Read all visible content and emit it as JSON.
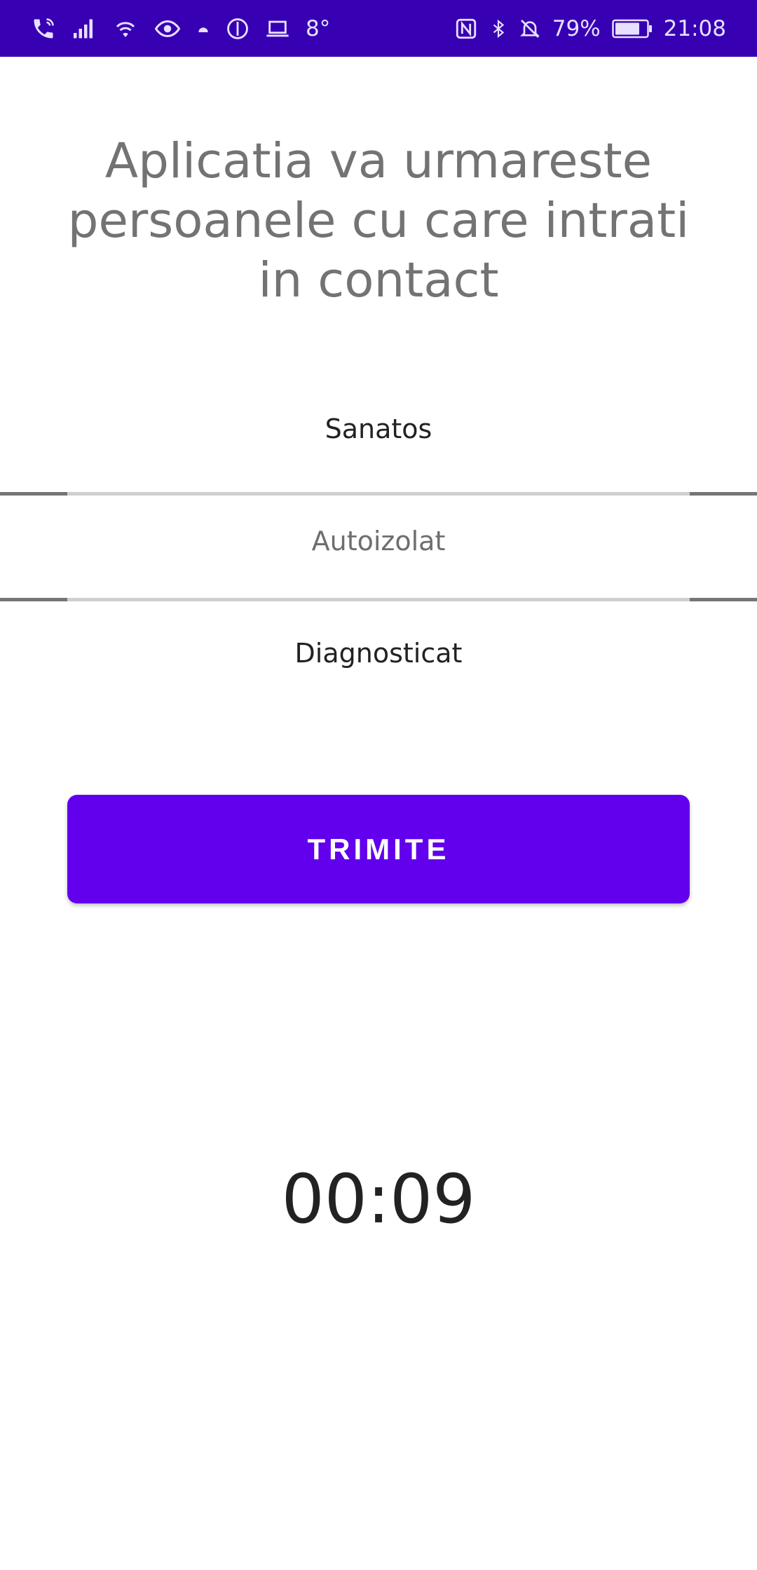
{
  "status_bar": {
    "temperature": "8°",
    "battery_percent": "79%",
    "time": "21:08",
    "background_color": "#3700b3",
    "icons_left": [
      "phone-wifi-calling-icon",
      "signal-icon",
      "wifi-icon",
      "eye-icon",
      "android-icon",
      "compass-icon",
      "laptop-icon"
    ],
    "icons_right": [
      "nfc-icon",
      "bluetooth-icon",
      "bell-off-icon",
      "battery-icon"
    ],
    "battery_level": 0.79
  },
  "headline": "Aplicatia va urmareste persoanele cu care intrati in contact",
  "status_picker": {
    "options": [
      "Sanatos",
      "Autoizolat",
      "Diagnosticat"
    ],
    "selected_index": 1,
    "selected_value": "Autoizolat"
  },
  "send_button": {
    "label": "TRIMITE",
    "color": "#6200ee"
  },
  "timer": "00:09"
}
